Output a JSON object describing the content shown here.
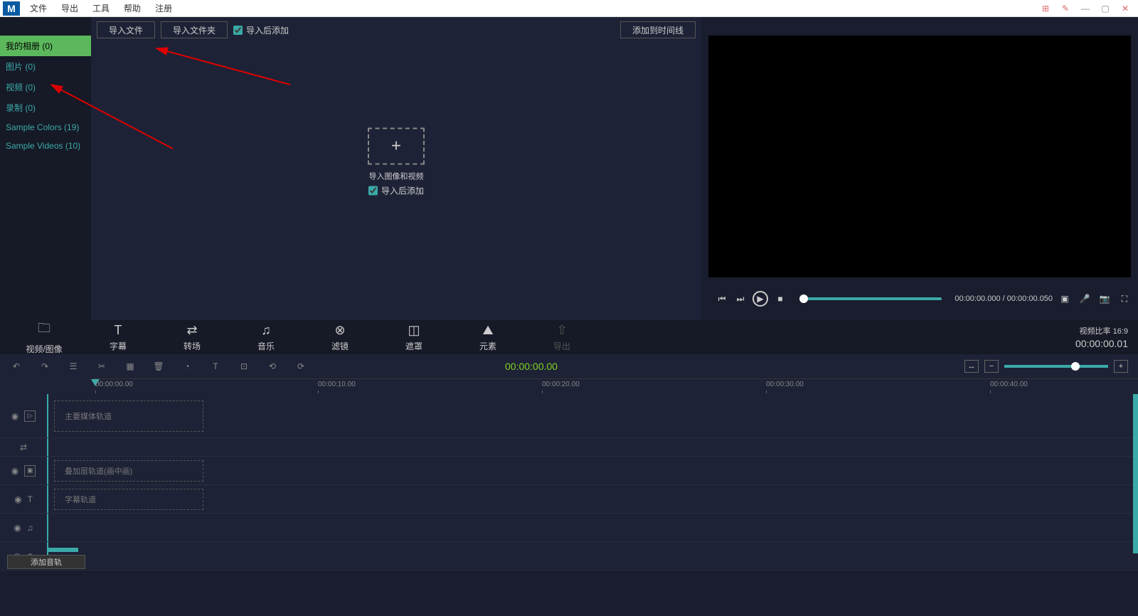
{
  "menus": {
    "file": "文件",
    "export": "导出",
    "tools": "工具",
    "help": "帮助",
    "register": "注册"
  },
  "sidebar": [
    {
      "label": "我的相册 (0)",
      "active": true
    },
    {
      "label": "图片 (0)"
    },
    {
      "label": "视频 (0)"
    },
    {
      "label": "录制 (0)"
    },
    {
      "label": "Sample Colors (19)"
    },
    {
      "label": "Sample Videos (10)"
    }
  ],
  "toolbar": {
    "import_file": "导入文件",
    "import_folder": "导入文件夹",
    "add_after_import": "导入后添加",
    "add_to_timeline": "添加到时间线"
  },
  "import_box": {
    "title": "导入图像和视频",
    "checkbox": "导入后添加",
    "plus": "+"
  },
  "preview": {
    "time_current": "00:00:00.000",
    "time_total": "00:00:00.050",
    "sep": " / "
  },
  "module_tabs": [
    {
      "label": "视频/图像",
      "icon": "folder"
    },
    {
      "label": "字幕",
      "icon": "text"
    },
    {
      "label": "转场",
      "icon": "transition"
    },
    {
      "label": "音乐",
      "icon": "music"
    },
    {
      "label": "滤镜",
      "icon": "filter"
    },
    {
      "label": "遮罩",
      "icon": "mask"
    },
    {
      "label": "元素",
      "icon": "element"
    },
    {
      "label": "导出",
      "icon": "export",
      "disabled": true
    }
  ],
  "module_right": {
    "ratio_label": "视频比率 16:9",
    "time": "00:00:00.01"
  },
  "tl_center_time": "00:00:00.00",
  "ruler": [
    {
      "t": "00:00:00.00",
      "pos": 0
    },
    {
      "t": "00:00:10.00",
      "pos": 315
    },
    {
      "t": "00:00:20.00",
      "pos": 630
    },
    {
      "t": "00:00:30.00",
      "pos": 945
    },
    {
      "t": "00:00:40.00",
      "pos": 1260
    }
  ],
  "tracks": {
    "main": "主要媒体轨道",
    "overlay": "叠加层轨道(画中画)",
    "subtitle": "字幕轨道"
  },
  "bottom": {
    "add_audio": "添加音轨"
  }
}
